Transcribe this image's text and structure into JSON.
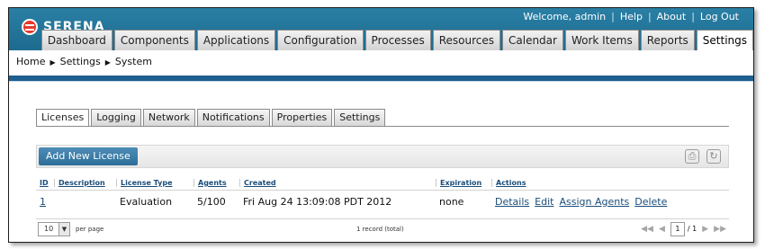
{
  "brand": {
    "name": "SERENA"
  },
  "user_links": [
    "Welcome, admin",
    "Help",
    "About",
    "Log Out"
  ],
  "nav_tabs": [
    "Dashboard",
    "Components",
    "Applications",
    "Configuration",
    "Processes",
    "Resources",
    "Calendar",
    "Work Items",
    "Reports",
    "Settings"
  ],
  "active_nav": "Settings",
  "breadcrumb": [
    "Home",
    "Settings",
    "System"
  ],
  "sub_tabs": [
    "Licenses",
    "Logging",
    "Network",
    "Notifications",
    "Properties",
    "Settings"
  ],
  "active_sub": "Licenses",
  "toolbar": {
    "add_label": "Add New License",
    "icons": [
      "print-icon",
      "refresh-icon"
    ]
  },
  "table": {
    "headers": [
      "ID",
      "Description",
      "License Type",
      "Agents",
      "Created",
      "Expiration",
      "Actions"
    ],
    "rows": [
      {
        "id": "1",
        "description": "",
        "type": "Evaluation",
        "agents": "5/100",
        "created": "Fri Aug 24 13:09:08 PDT 2012",
        "expiration": "none",
        "actions": [
          "Details",
          "Edit",
          "Assign Agents",
          "Delete"
        ]
      }
    ]
  },
  "footer": {
    "per_page_value": "10",
    "per_page_label": "per page",
    "total": "1 record (total)",
    "page": "1",
    "of_pages": "/ 1"
  },
  "colors": {
    "header": "#1d6b8f",
    "band": "#1f5f8f",
    "link": "#1a4d7a",
    "button": "#2d6e98"
  }
}
